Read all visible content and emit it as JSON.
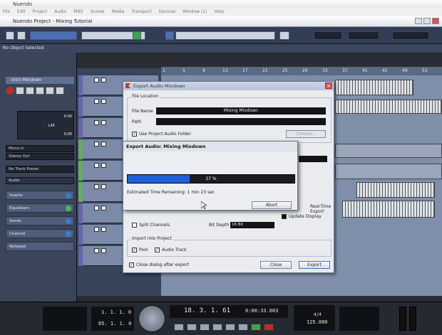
{
  "app": {
    "title": "Nuendo",
    "menus": [
      "File",
      "Edit",
      "Project",
      "Audio",
      "MIDI",
      "Scores",
      "Media",
      "Transport",
      "Devices",
      "Window (1)",
      "Help"
    ]
  },
  "project": {
    "title": "Nuendo Project - Mixing Tutorial"
  },
  "status": {
    "text": "No Object Selected"
  },
  "inspector": {
    "track_name": "Intro Mixdown",
    "fader_value": "0.00",
    "pan_value": "L45",
    "value3": "0.00",
    "routing": [
      "Mono In",
      "Stereo Out"
    ],
    "preset": "No Track Preset",
    "section_audio": "Audio",
    "sections": [
      "Inserts",
      "Equalizers",
      "Sends",
      "Channel",
      "Notepad"
    ]
  },
  "ruler": {
    "bars": [
      "1",
      "5",
      "9",
      "13",
      "17",
      "21",
      "25",
      "29",
      "33",
      "37",
      "41",
      "45",
      "49",
      "53"
    ]
  },
  "export_dialog": {
    "title": "Export Audio Mixdown",
    "file_location_label": "File Location",
    "file_name_label": "File Name",
    "file_name_value": "Mixing Mixdown",
    "path_label": "Path",
    "use_project_folder_label": "Use Project Audio Folder",
    "choose_label": "Choose...",
    "realtime_label": "Real-Time Export",
    "update_display_label": "Update Display",
    "split_channels_label": "Split Channels",
    "bit_depth_label": "Bit Depth",
    "bit_depth_value": "16 Bit",
    "import_label": "Import into Project",
    "pool_label": "Pool",
    "audio_track_label": "Audio Track",
    "close_after_label": "Close dialog after export",
    "close_button": "Close",
    "export_button": "Export"
  },
  "progress": {
    "title": "Export Audio: Mixing Mixdown",
    "percent": 37,
    "percent_label": "37 %",
    "remaining": "Estimated Time Remaining: 1 min 23 sec",
    "abort_label": "Abort"
  },
  "transport": {
    "left_locator": "1. 1. 1. 0",
    "right_locator": "85. 1. 1. 0",
    "position": "18. 3. 1. 61",
    "time": "0:00:33.003",
    "tempo": "125.000",
    "signature": "4/4"
  },
  "colors": {
    "accent": "#1f5fd8",
    "record": "#c62828",
    "play": "#3da34a"
  }
}
